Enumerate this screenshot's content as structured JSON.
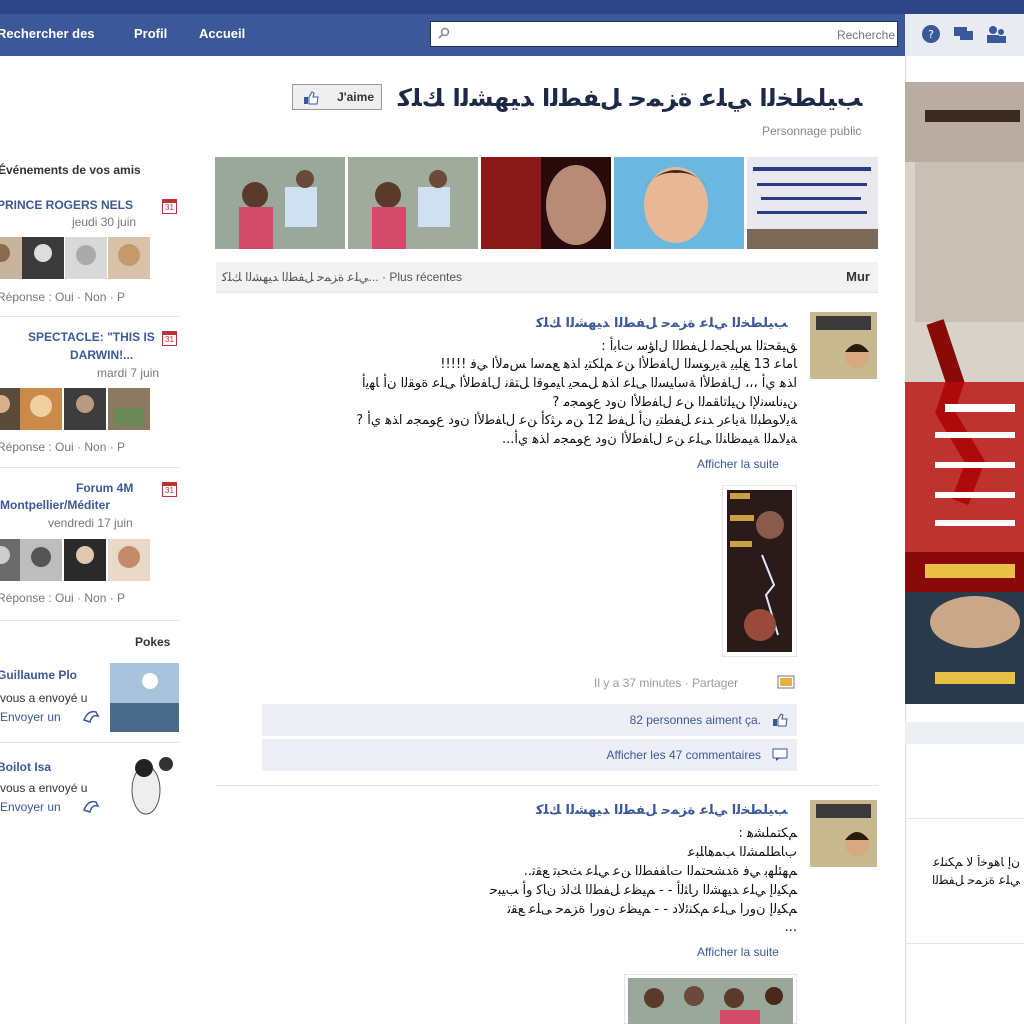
{
  "nav": {
    "items": [
      "Accueil",
      "Profil",
      "Rechercher des"
    ],
    "search_placeholder": "Recherche"
  },
  "page": {
    "title": "ﺐﻴﻠﻄﺨﻟﺍ ﻲﻠﻋ ﺓﺰﻤﺣ ﻞﻔﻄﻟﺍ ﺪﻴﻬﺸﻟﺍ ﻚﻠﻛ",
    "category": "Personnage public",
    "like_label": "J'aime"
  },
  "wall": {
    "label": "Mur",
    "filter": "ﻲﻠﻋ ﺓﺰﻤﺣ ﻞﻔﻄﻟﺍ ﺪﻴﻬﺸﻟﺍ ﻚﻠﻛ... · Plus récentes"
  },
  "posts": [
    {
      "author": "ﺐﻴﻠﻄﺨﻟﺍ ﻲﻠﻋ ﺓﺰﻤﺣ ﻞﻔﻄﻟﺍ ﺪﻴﻬﺸﻟﺍ ﻚﻠﻛ",
      "lines": [
        ": ﻖﻴﻘﺤﺘﻟﺍ ﺲﻠﺠﻤﻟ ﻞﻔﻄﻟﺍ ﻝﺍﺆﺳ ﺕﺎﺑﺃ",
        "!!!!! ﺎﻣﺎﻋ 13 ﻎﻠﺒﻳ ﺔﻳﺭﻮﺴﻟﺍ ﻝﺎﻔﻃﻷﺍ ﻦﻋ ﻢﻠﻜﺘﻳ ﺍﺬﻫ ﻊﻤﺳﺍ ﺲﻣﻷﺍ ﻲﻓ",
        "ﺍﺬﻫ ﻱﺃ ،،، ﻝﺎﻔﻃﻷﺍ ﺔﺳﺎﻴﺴﻟﺍ ﻰﻠﻋ ﺍﺬﻫ ﻞﻤﺤﻳ ﺎﻴﻣﻮﻗﺍ ﻞﺘﻘﻧ ﻝﺎﻔﻃﻷﺍ ﻰﻠﻋ ﺓﻮﻘﻟﺍ ﻥﺃ ﺎﻬﻳﺃ",
        "? ﻦﻴﻧﺎﺴﻧﻹﺍ ﻦﻴﻠﺗﺎﻘﻤﻟﺍ ﻦﻋ ﻝﺎﻔﻃﻷﺍ ﻥﻭﺩ ﻉﻮﻤﺠﻣ",
        "? ﺔﻳﻻﻮﻄﺒﻟﺍ ﺔﻳﺎﻋﺭ ﺪﻨﻋ ﻞﻔﻄﺘﻳ ﻥﺃ ﻞﻔﻃ 12 ﻦﻣ ﺮﺜﻛﺃ ﻦﻋ ﻝﺎﻔﻃﻷﺍ ﻥﻭﺩ ﻉﻮﻤﺠﻣ ﺍﺬﻫ ﻱﺃ",
        "...ﺔﻴﻟﺎﻤﻟﺍ ﺔﻴﻤﻇﺎﻨﻟﺍ ﻰﻠﻋ ﻦﻋ ﻝﺎﻔﻃﻷﺍ ﻥﻭﺩ ﻉﻮﻤﺠﻣ ﺍﺬﻫ ﻱﺃ"
      ],
      "more": "Afficher la suite",
      "meta": "Il y a 37 minutes · Partager",
      "likes": "82 personnes aiment ça.",
      "comments": "Afficher les 47 commentaires"
    },
    {
      "author": "ﺐﻴﻠﻄﺨﻟﺍ ﻲﻠﻋ ﺓﺰﻤﺣ ﻞﻔﻄﻟﺍ ﺪﻴﻬﺸﻟﺍ ﻚﻠﻛ",
      "lines": [
        ": ﻢﻜﺘﻤﻠﺸﻫ",
        "ﺏﺎﻄﻠﻤﺸﻟﺍ ﺐﻤﻫﺎﻠﺒﻋ",
        "..ﻢﻬﺌﻠﻬﺑ ﻲﻓ ﺓﺪﺸﺤﺘﻤﻟﺍ ﺕﺎﻔﻔﻄﻟﺍ ﻦﻋ ﻲﻠﻋ ﺚﺤﺒﺗ ﻊﻘﺗ",
        "ﻢﻜﻴﻟﺇ ﻲﻠﻋ ﺪﻴﻬﺸﻟﺍ ﺭﺎﺜﻟﺃ - - ﻢﻴﻈﻋ ﻞﻔﻄﻟﺍ ﻚﻟﺫ ﻥﺎﻛ ﻭﺃ ﺐﻴﺒﺣ",
        "ﻢﻜﻴﻟﺇ ﻥﻭﺭﺍ ﻰﻠﻋ ﻢﻜﻨﺋﻻﺩ - - ﻢﻴﻈﻋ ﻥﻭﺭﺍ ﺓﺰﻤﺣ ﻰﻠﻋ ﻊﻘﺗ",
        "..."
      ],
      "more": "Afficher la suite"
    }
  ],
  "left": {
    "events_title": "Événements de vos amis",
    "events": [
      {
        "cal": "31",
        "title": "PRINCE ROGERS NELS",
        "date": "jeudi 30 juin",
        "rsvp": "Réponse : Oui · Non · P"
      },
      {
        "cal": "31",
        "title": "SPECTACLE: \"THIS IS",
        "title2": "DARWIN!...",
        "date": "mardi 7 juin",
        "rsvp": "Réponse : Oui · Non · P"
      },
      {
        "cal": "31",
        "title": "Forum 4M",
        "title2": "Montpellier/Méditer",
        "date": "vendredi 17 juin",
        "rsvp": "Réponse : Oui · Non · P"
      }
    ],
    "pokes_title": "Pokes",
    "pokes": [
      {
        "name": "Guillaume Plo",
        "text": "vous a envoyé u",
        "action": "Envoyer un"
      },
      {
        "name": "Boilot Isa",
        "text": "vous a envoyé u",
        "action": "Envoyer un"
      }
    ]
  },
  "right": {
    "text_line1": "ﻥﺇ ﺎﻫﻮﺧﺃ ﻻ ﻢﻜﻨﻠﻋ",
    "text_line2": "ﻲﻠﻋ ﺓﺰﻤﺣ ﻞﻔﻄﻟﺍ"
  },
  "colors": {
    "topbar": "#3b5998",
    "link": "#3b5998",
    "ufi_bg": "#edeff4"
  }
}
